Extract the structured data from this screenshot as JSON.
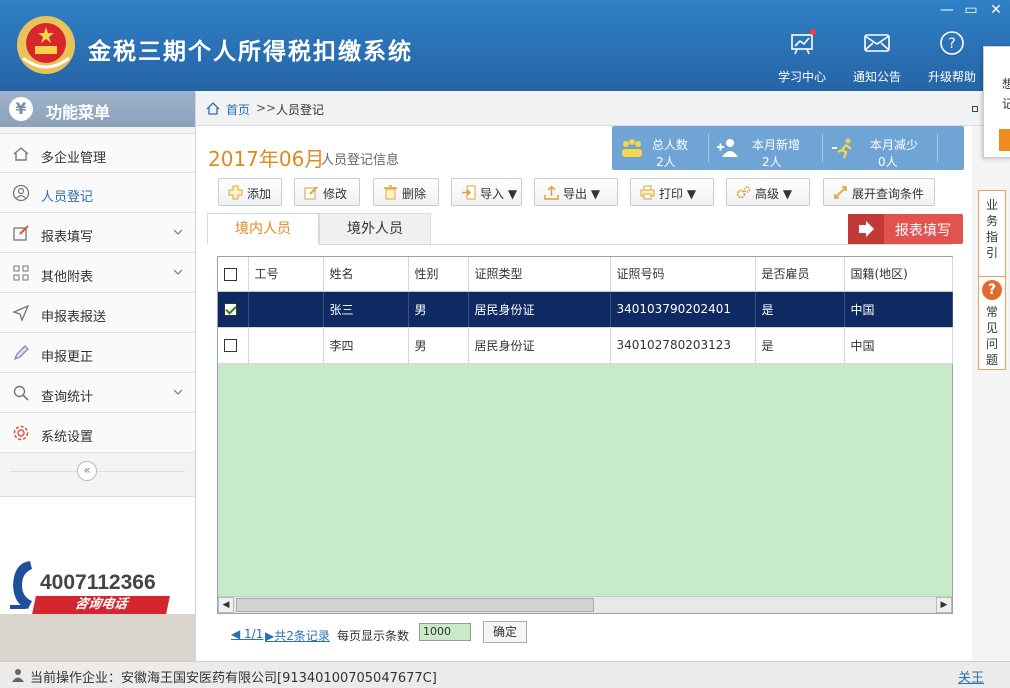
{
  "header": {
    "title": "金税三期个人所得税扣缴系统",
    "buttons": [
      {
        "label": "学习中心",
        "icon": "learning-center-icon"
      },
      {
        "label": "通知公告",
        "icon": "envelope-icon"
      },
      {
        "label": "升级帮助",
        "icon": "help-icon"
      }
    ],
    "window": {
      "minimize": "—",
      "maximize": "▭",
      "close": "✕"
    }
  },
  "sidebar": {
    "title": "功能菜单",
    "items": [
      {
        "label": "多企业管理",
        "icon": "home-icon",
        "chevron": false
      },
      {
        "label": "人员登记",
        "icon": "user-icon",
        "chevron": false,
        "active": true
      },
      {
        "label": "报表填写",
        "icon": "edit-icon",
        "chevron": true
      },
      {
        "label": "其他附表",
        "icon": "grid-icon",
        "chevron": true
      },
      {
        "label": "申报表报送",
        "icon": "send-icon",
        "chevron": false
      },
      {
        "label": "申报更正",
        "icon": "pen-icon",
        "chevron": false
      },
      {
        "label": "查询统计",
        "icon": "search-icon",
        "chevron": true
      },
      {
        "label": "系统设置",
        "icon": "gear-icon",
        "chevron": false
      }
    ],
    "collapse": "«",
    "hotline_number": "4007112366",
    "hotline_label": "咨询电话"
  },
  "breadcrumb": {
    "home": "首页",
    "sep": ">>",
    "current": "人员登记"
  },
  "page": {
    "period": "2017年06月",
    "period_sub": "人员登记信息",
    "stats": [
      {
        "label": "总人数",
        "value": "2人"
      },
      {
        "label": "本月新增",
        "value": "2人"
      },
      {
        "label": "本月减少",
        "value": "0人"
      }
    ],
    "toolbar": [
      {
        "label": "添加",
        "icon": "add-icon"
      },
      {
        "label": "修改",
        "icon": "modify-icon"
      },
      {
        "label": "删除",
        "icon": "trash-icon"
      },
      {
        "label": "导入 ▼",
        "icon": "import-icon"
      },
      {
        "label": "导出 ▼",
        "icon": "export-icon"
      },
      {
        "label": "打印 ▼",
        "icon": "print-icon"
      },
      {
        "label": "高级 ▼",
        "icon": "advanced-icon"
      },
      {
        "label": "展开查询条件",
        "icon": "expand-icon"
      }
    ],
    "tabs": [
      "境内人员",
      "境外人员"
    ],
    "report_button": "报表填写"
  },
  "table": {
    "columns": [
      "工号",
      "姓名",
      "性别",
      "证照类型",
      "证照号码",
      "是否雇员",
      "国籍(地区)"
    ],
    "rows": [
      {
        "checked": true,
        "cells": [
          "",
          "张三",
          "男",
          "居民身份证",
          "340103790202401",
          "是",
          "中国"
        ]
      },
      {
        "checked": false,
        "cells": [
          "",
          "李四",
          "男",
          "居民身份证",
          "340102780203123",
          "是",
          "中国"
        ]
      }
    ]
  },
  "pager": {
    "page": "1/1",
    "total": "共2条记录",
    "page_size_label": "每页显示条数",
    "page_size": "1000",
    "confirm": "确定"
  },
  "right_panel": {
    "guide": "业务指引",
    "faq": "常见问题",
    "faq_icon": "?",
    "popup_chars": [
      "想",
      "记"
    ]
  },
  "status": {
    "text": "当前操作企业：安徽海王国安医药有限公司[91340100705047677C]",
    "close": "关王"
  },
  "colors": {
    "primary": "#2a6fb3",
    "accent": "#e08a1e",
    "selected_row": "#0f2a63",
    "grid_bg": "#c7ebc9",
    "report": "#e1534f"
  }
}
